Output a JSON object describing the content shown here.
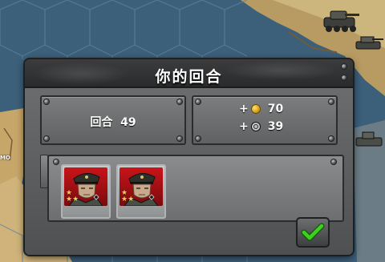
{
  "dialog": {
    "title": "你的回合",
    "turn_label": "回合",
    "turn_number": "49",
    "resources": [
      {
        "sign": "+",
        "icon": "gold-coin-icon",
        "value": "70"
      },
      {
        "sign": "+",
        "icon": "industry-gear-icon",
        "value": "39"
      }
    ],
    "generals": [
      {
        "stars": 2,
        "portrait": "general-portrait-icon"
      },
      {
        "stars": 2,
        "portrait": "general-portrait-icon"
      }
    ]
  },
  "map": {
    "label_fragment": "MO"
  },
  "colors": {
    "sea": "#3c5f7a",
    "land": "#cbb27a",
    "general_bg": "#c8141a",
    "confirm_check": "#3ecf1f"
  }
}
